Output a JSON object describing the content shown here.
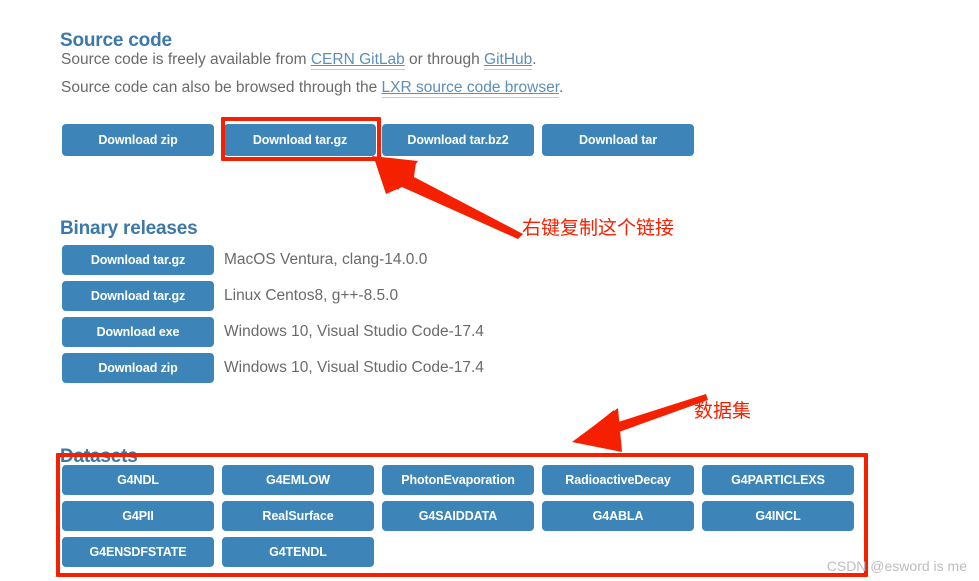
{
  "sections": {
    "source_code": {
      "heading": "Source code",
      "paragraph_1_prefix": "Source code is freely available from ",
      "paragraph_1_link_1": "CERN GitLab",
      "paragraph_1_middle": " or through ",
      "paragraph_1_link_2": "GitHub",
      "paragraph_1_suffix": ".",
      "paragraph_2_prefix": "Source code can also be browsed through the ",
      "paragraph_2_link_1": "LXR source code browser",
      "paragraph_2_suffix": ".",
      "buttons": [
        {
          "label": "Download zip"
        },
        {
          "label": "Download tar.gz"
        },
        {
          "label": "Download tar.bz2"
        },
        {
          "label": "Download tar"
        }
      ]
    },
    "binary_releases": {
      "heading": "Binary releases",
      "rows": [
        {
          "button_label": "Download tar.gz",
          "description": "MacOS Ventura, clang-14.0.0"
        },
        {
          "button_label": "Download tar.gz",
          "description": "Linux Centos8, g++-8.5.0"
        },
        {
          "button_label": "Download exe",
          "description": "Windows 10, Visual Studio Code-17.4"
        },
        {
          "button_label": "Download zip",
          "description": "Windows 10, Visual Studio Code-17.4"
        }
      ]
    },
    "datasets": {
      "heading": "Datasets",
      "buttons": [
        {
          "label": "G4NDL"
        },
        {
          "label": "G4EMLOW"
        },
        {
          "label": "PhotonEvaporation"
        },
        {
          "label": "RadioactiveDecay"
        },
        {
          "label": "G4PARTICLEXS"
        },
        {
          "label": "G4PII"
        },
        {
          "label": "RealSurface"
        },
        {
          "label": "G4SAIDDATA"
        },
        {
          "label": "G4ABLA"
        },
        {
          "label": "G4INCL"
        },
        {
          "label": "G4ENSDFSTATE"
        },
        {
          "label": "G4TENDL"
        }
      ]
    }
  },
  "annotations": {
    "color": "#f52000",
    "callout_1_text": "右键复制这个链接",
    "callout_2_text": "数据集"
  },
  "watermark": "CSDN @esword is me",
  "colors": {
    "button_blue": "#3d85b8",
    "heading_blue": "#3c78a8",
    "link_blue": "#5b8fb9",
    "body_gray": "#6a6a6a",
    "annotation_red": "#f52000",
    "watermark_gray": "#bdbdbd"
  }
}
